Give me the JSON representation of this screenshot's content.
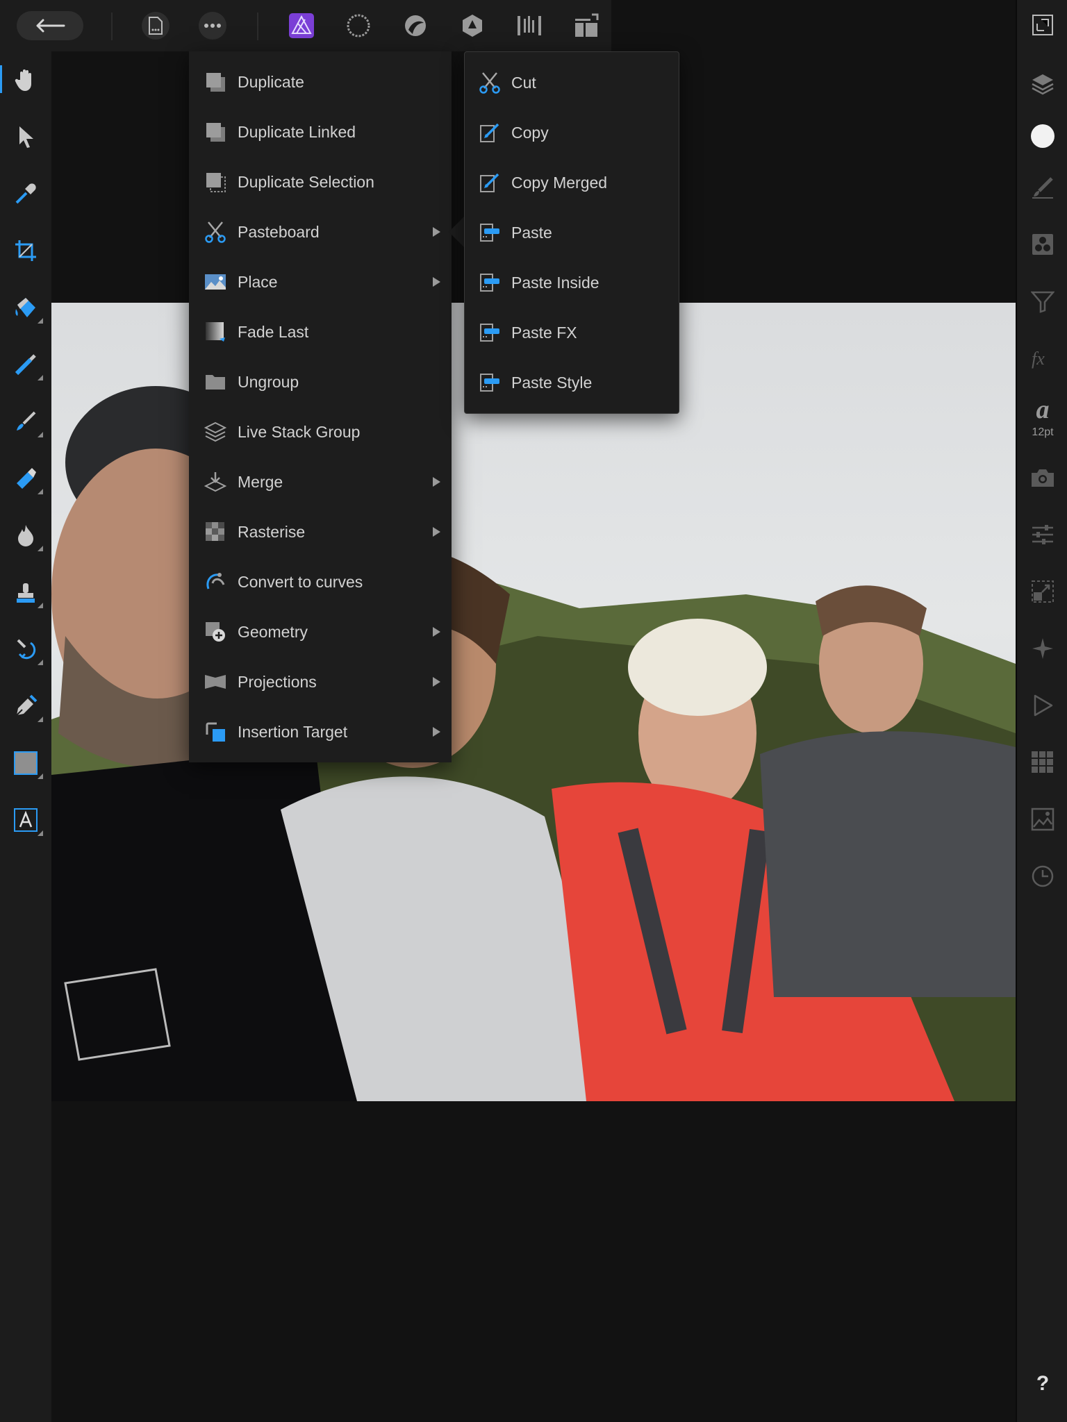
{
  "app": {
    "name": "Affinity Photo",
    "accent_color": "#2b9bf4",
    "persona_color": "#7b3fd6"
  },
  "top_toolbar": {
    "icons": [
      "back-arrow-icon",
      "document-icon",
      "more-icon",
      "photo-persona-icon",
      "liquify-persona-icon",
      "develop-persona-icon",
      "tone-mapping-persona-icon",
      "export-persona-icon",
      "arrange-icon"
    ]
  },
  "left_tools": [
    "view-tool-icon",
    "move-tool-icon",
    "color-picker-icon",
    "crop-tool-icon",
    "flood-fill-icon",
    "selection-brush-icon",
    "paint-brush-icon",
    "erase-brush-icon",
    "dodge-burn-icon",
    "clone-stamp-icon",
    "red-eye-icon",
    "pen-tool-icon",
    "rectangle-tool-icon",
    "text-tool-icon"
  ],
  "right_panel": {
    "font_size": "12pt",
    "help": "?",
    "icons": [
      "navigator-icon",
      "layers-icon",
      "color-icon",
      "brushes-icon",
      "channels-icon",
      "adjustments-icon",
      "fx-icon",
      "text-style-icon",
      "camera-icon",
      "sliders-icon",
      "transform-icon",
      "snapping-icon",
      "play-icon",
      "grid-icon",
      "stock-icon",
      "history-icon"
    ]
  },
  "edit_menu": {
    "items": [
      {
        "label": "Duplicate",
        "icon": "duplicate-icon",
        "has_submenu": false
      },
      {
        "label": "Duplicate Linked",
        "icon": "duplicate-linked-icon",
        "has_submenu": false
      },
      {
        "label": "Duplicate Selection",
        "icon": "duplicate-selection-icon",
        "has_submenu": false
      },
      {
        "label": "Pasteboard",
        "icon": "scissors-icon",
        "has_submenu": true
      },
      {
        "label": "Place",
        "icon": "place-image-icon",
        "has_submenu": true
      },
      {
        "label": "Fade Last",
        "icon": "fade-icon",
        "has_submenu": false
      },
      {
        "label": "Ungroup",
        "icon": "folder-icon",
        "has_submenu": false
      },
      {
        "label": "Live Stack Group",
        "icon": "stack-icon",
        "has_submenu": false
      },
      {
        "label": "Merge",
        "icon": "merge-icon",
        "has_submenu": true
      },
      {
        "label": "Rasterise",
        "icon": "rasterise-icon",
        "has_submenu": true
      },
      {
        "label": "Convert to curves",
        "icon": "curves-icon",
        "has_submenu": false
      },
      {
        "label": "Geometry",
        "icon": "geometry-icon",
        "has_submenu": true
      },
      {
        "label": "Projections",
        "icon": "projections-icon",
        "has_submenu": true
      },
      {
        "label": "Insertion Target",
        "icon": "insertion-target-icon",
        "has_submenu": true
      }
    ]
  },
  "pasteboard_submenu": {
    "items": [
      {
        "label": "Cut",
        "icon": "cut-icon"
      },
      {
        "label": "Copy",
        "icon": "copy-icon"
      },
      {
        "label": "Copy Merged",
        "icon": "copy-merged-icon"
      },
      {
        "label": "Paste",
        "icon": "paste-icon"
      },
      {
        "label": "Paste Inside",
        "icon": "paste-inside-icon"
      },
      {
        "label": "Paste FX",
        "icon": "paste-fx-icon"
      },
      {
        "label": "Paste Style",
        "icon": "paste-style-icon"
      }
    ]
  }
}
